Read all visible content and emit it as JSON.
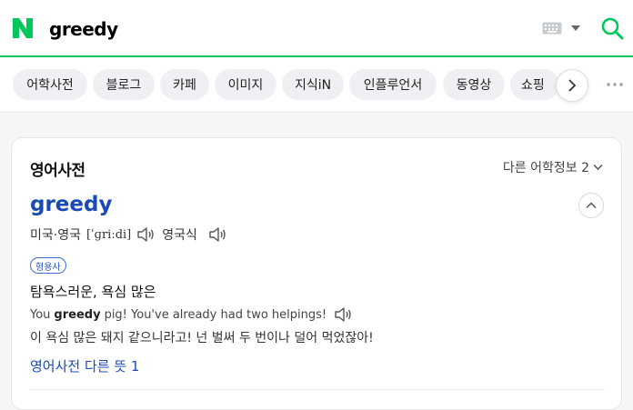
{
  "search": {
    "query": "greedy",
    "brand_color": "#03c75a"
  },
  "icons": {
    "logo": "naver-n-logo",
    "keyboard": "keyboard-icon",
    "search": "search-icon",
    "next": "chevron-right-icon",
    "more": "more-dots-icon"
  },
  "tabs": [
    {
      "label": "어학사전"
    },
    {
      "label": "블로그"
    },
    {
      "label": "카페"
    },
    {
      "label": "이미지"
    },
    {
      "label": "지식iN"
    },
    {
      "label": "인플루언서"
    },
    {
      "label": "동영상"
    },
    {
      "label": "쇼핑"
    }
  ],
  "card": {
    "title": "영어사전",
    "other_info": "다른 어학정보 2",
    "word": "greedy",
    "pron_label": "미국·영국",
    "ipa": "[ˈɡriːdi]",
    "pron_label_uk": "영국식",
    "pos": "형용사",
    "meaning": "탐욕스러운, 욕심 많은",
    "example_en_before": "You",
    "example_en_bold": "greedy",
    "example_en_after": "pig! You've already had two helpings!",
    "example_ko": "이 욕심 많은 돼지 같으니라고! 넌 벌써 두 번이나 덜어 먹었잖아!",
    "more_meaning": "영어사전 다른 뜻 1"
  }
}
